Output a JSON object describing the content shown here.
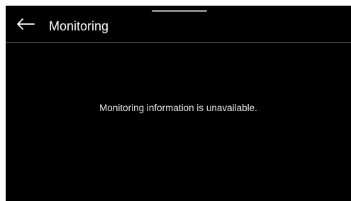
{
  "header": {
    "back_icon": "arrow-left-icon",
    "title": "Monitoring"
  },
  "content": {
    "message": "Monitoring information is unavailable."
  },
  "colors": {
    "background": "#000000",
    "text": "#ffffff",
    "divider": "#6b6b6b",
    "drag_handle": "#8a8a8a"
  }
}
